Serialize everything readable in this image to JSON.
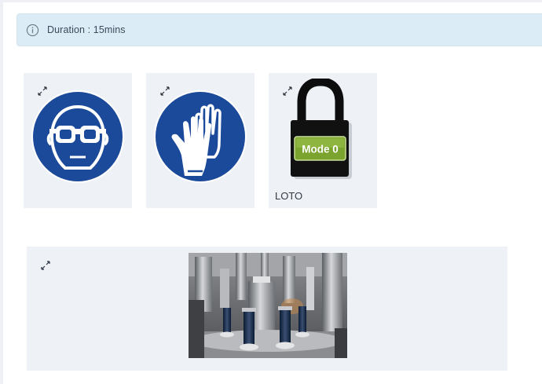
{
  "banner": {
    "duration_text": "Duration : 15mins",
    "icon": "info-icon"
  },
  "ppe_cards": [
    {
      "icon": "safety-goggles-icon",
      "caption": ""
    },
    {
      "icon": "protective-gloves-icon",
      "caption": ""
    },
    {
      "icon": "padlock-icon",
      "caption": "LOTO",
      "lock_label": "Mode 0"
    }
  ],
  "media_card": {
    "image": "machine-photo"
  },
  "colors": {
    "banner_bg": "#dcecf6",
    "card_bg": "#eef1f6",
    "sign_blue": "#1b4a9a",
    "lock_green": "#7aa42e"
  }
}
